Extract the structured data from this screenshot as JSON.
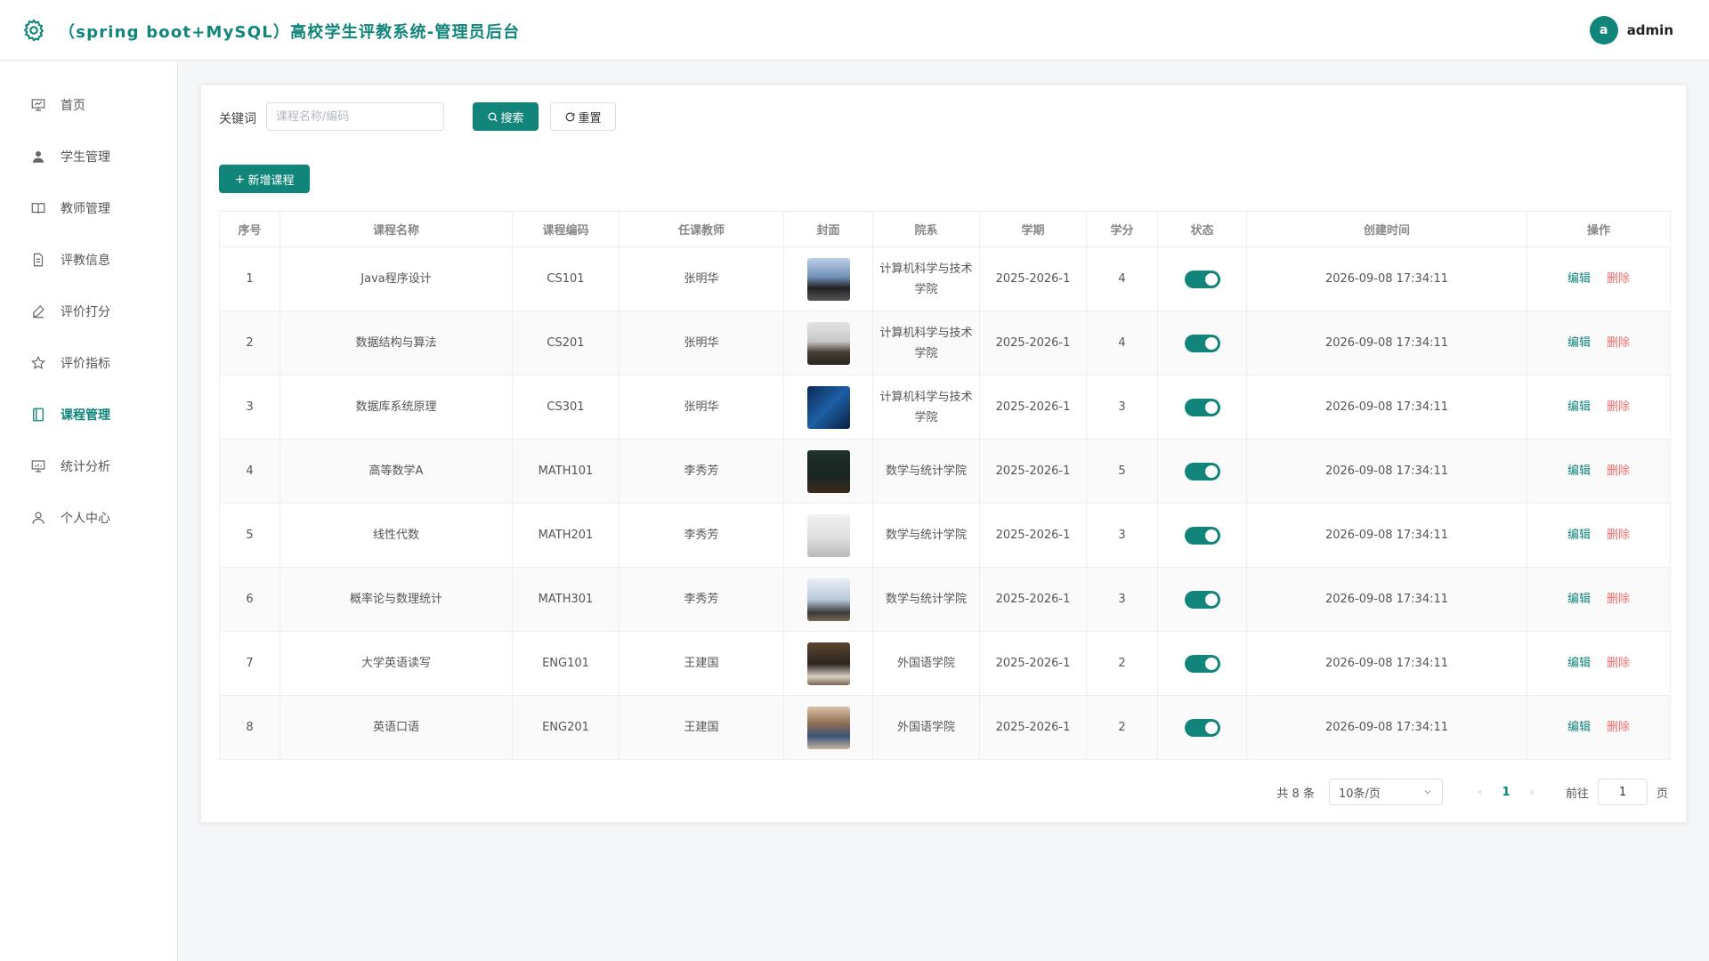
{
  "header": {
    "title": "（spring boot+MySQL）高校学生评教系统-管理员后台",
    "avatar_letter": "a",
    "username": "admin",
    "accent_color": "#11857a"
  },
  "sidebar": {
    "items": [
      {
        "label": "首页",
        "icon": "presentation-icon",
        "active": false
      },
      {
        "label": "学生管理",
        "icon": "user-filled-icon",
        "active": false
      },
      {
        "label": "教师管理",
        "icon": "book-open-icon",
        "active": false
      },
      {
        "label": "评教信息",
        "icon": "document-icon",
        "active": false
      },
      {
        "label": "评价打分",
        "icon": "pen-icon",
        "active": false
      },
      {
        "label": "评价指标",
        "icon": "star-icon",
        "active": false
      },
      {
        "label": "课程管理",
        "icon": "notebook-icon",
        "active": true
      },
      {
        "label": "统计分析",
        "icon": "chart-board-icon",
        "active": false
      },
      {
        "label": "个人中心",
        "icon": "user-outline-icon",
        "active": false
      }
    ]
  },
  "search": {
    "keyword_label": "关键词",
    "placeholder": "课程名称/编码",
    "value": "",
    "search_label": "搜索",
    "reset_label": "重置",
    "add_label": "新增课程"
  },
  "table": {
    "headers": [
      "序号",
      "课程名称",
      "课程编码",
      "任课教师",
      "封面",
      "院系",
      "学期",
      "学分",
      "状态",
      "创建时间",
      "操作"
    ],
    "edit_label": "编辑",
    "delete_label": "删除",
    "rows": [
      {
        "idx": "1",
        "name": "Java程序设计",
        "code": "CS101",
        "teacher": "张明华",
        "cover": "laptop-cover",
        "dept": "计算机科学与技术学院",
        "term": "2025-2026-1",
        "credit": "4",
        "status": true,
        "created": "2026-09-08 17:34:11"
      },
      {
        "idx": "2",
        "name": "数据结构与算法",
        "code": "CS201",
        "teacher": "张明华",
        "cover": "lecture-cover",
        "dept": "计算机科学与技术学院",
        "term": "2025-2026-1",
        "credit": "4",
        "status": true,
        "created": "2026-09-08 17:34:11"
      },
      {
        "idx": "3",
        "name": "数据库系统原理",
        "code": "CS301",
        "teacher": "张明华",
        "cover": "server-cover",
        "dept": "计算机科学与技术学院",
        "term": "2025-2026-1",
        "credit": "3",
        "status": true,
        "created": "2026-09-08 17:34:11"
      },
      {
        "idx": "4",
        "name": "高等数学A",
        "code": "MATH101",
        "teacher": "李秀芳",
        "cover": "blackboard-cover",
        "dept": "数学与统计学院",
        "term": "2025-2026-1",
        "credit": "5",
        "status": true,
        "created": "2026-09-08 17:34:11"
      },
      {
        "idx": "5",
        "name": "线性代数",
        "code": "MATH201",
        "teacher": "李秀芳",
        "cover": "whiteboard-cover",
        "dept": "数学与统计学院",
        "term": "2025-2026-1",
        "credit": "3",
        "status": true,
        "created": "2026-09-08 17:34:11"
      },
      {
        "idx": "6",
        "name": "概率论与数理统计",
        "code": "MATH301",
        "teacher": "李秀芳",
        "cover": "stats-cover",
        "dept": "数学与统计学院",
        "term": "2025-2026-1",
        "credit": "3",
        "status": true,
        "created": "2026-09-08 17:34:11"
      },
      {
        "idx": "7",
        "name": "大学英语读写",
        "code": "ENG101",
        "teacher": "王建国",
        "cover": "library-cover",
        "dept": "外国语学院",
        "term": "2025-2026-1",
        "credit": "2",
        "status": true,
        "created": "2026-09-08 17:34:11"
      },
      {
        "idx": "8",
        "name": "英语口语",
        "code": "ENG201",
        "teacher": "王建国",
        "cover": "classroom-cover",
        "dept": "外国语学院",
        "term": "2025-2026-1",
        "credit": "2",
        "status": true,
        "created": "2026-09-08 17:34:11"
      }
    ]
  },
  "pagination": {
    "total_text": "共 8 条",
    "page_size": "10条/页",
    "current_page": "1",
    "goto_label": "前往",
    "goto_value": "1",
    "page_suffix": "页"
  }
}
